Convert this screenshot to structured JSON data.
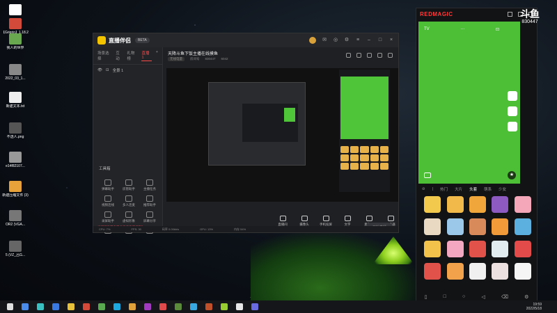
{
  "desktop": {
    "icons": [
      {
        "label": "",
        "color": "#ffffff"
      },
      {
        "label": "【Grigrin】1.18.2 整合...",
        "color": "#d44a3a"
      },
      {
        "label": "我人的世界",
        "color": "#6aa84f"
      },
      {
        "label": "2022_03_1...",
        "color": "#888888"
      },
      {
        "label": "新建文本.txt",
        "color": "#eeeeee"
      },
      {
        "label": "不透人.png",
        "color": "#555555"
      },
      {
        "label": "e14f82107...",
        "color": "#999999"
      },
      {
        "label": "新建压缩文件 (3)",
        "color": "#e8a23a"
      },
      {
        "label": "OR2 (VGA...",
        "color": "#777777"
      },
      {
        "label": "5 (VZ_吕G...",
        "color": "#666666"
      }
    ]
  },
  "app": {
    "name": "直播伴侣",
    "badge": "BETA",
    "tabs": [
      "场景选择",
      "互动",
      "礼物榜",
      "直播 1"
    ],
    "scene": "全景 1",
    "tools_title": "工具箱",
    "tools": [
      "弹幕助手",
      "房管助手",
      "主播任务",
      "视频连线",
      "多人连麦",
      "推荐助手",
      "录屏助手",
      "虚拟形象",
      "屏幕分享",
      "",
      "",
      ""
    ],
    "notice": "如何拥有开启安全高清直播权限？",
    "live_title": "天降斗鱼下饭主播在线摸鱼",
    "live_sub": [
      "无线电量",
      "房间号",
      "830447",
      "6042"
    ],
    "controls": [
      "直播间",
      "摄像头",
      "手机投屏",
      "文字",
      "麦克风",
      "扬声器"
    ],
    "start_live": "开始直播",
    "status": [
      "CPU: 7%",
      "FPS: 30",
      "码率 0.00kb/s",
      "GPU: 13%",
      "内存 54%"
    ]
  },
  "phone": {
    "brand": "REDMAGIC",
    "top_icons": [
      "TV",
      "···",
      "⊡"
    ],
    "categories": [
      "⊘",
      "|",
      "热门",
      "大片",
      "头套",
      "萌系",
      "少女"
    ],
    "active_category": "头套",
    "sticker_colors": [
      "#f2c94c",
      "#f1b84a",
      "#f0a63a",
      "#8d5ac2",
      "#f4a7b9",
      "#e9d9c2",
      "#9bc7e8",
      "#d98a5a",
      "#f09a3a",
      "#5bb0e0",
      "#f3c24a",
      "#f4a7c1",
      "#e0524a",
      "#e0ecf0",
      "#e34a4a",
      "#e0524a",
      "#f2a24a",
      "#f0f0f0",
      "#ece0e0",
      "#f5f5f5"
    ],
    "nav": [
      "▯",
      "□",
      "○",
      "◁",
      "⌫",
      "⚙"
    ]
  },
  "watermark": {
    "logo": "斗鱼",
    "room": "830447"
  },
  "taskbar": {
    "time": "19:59",
    "date": "2022/5/18",
    "icon_colors": [
      "#e0e0e0",
      "#4a8ae8",
      "#3ac0c0",
      "#3a7ae0",
      "#e8c23a",
      "#d44a3a",
      "#5aa84f",
      "#1ea8e0",
      "#e0a03a",
      "#a23ac0",
      "#e04a4a",
      "#5a8a3a",
      "#3aa8e0",
      "#c0502a",
      "#9acd32",
      "#e8e8e8",
      "#6a6ae0"
    ]
  }
}
